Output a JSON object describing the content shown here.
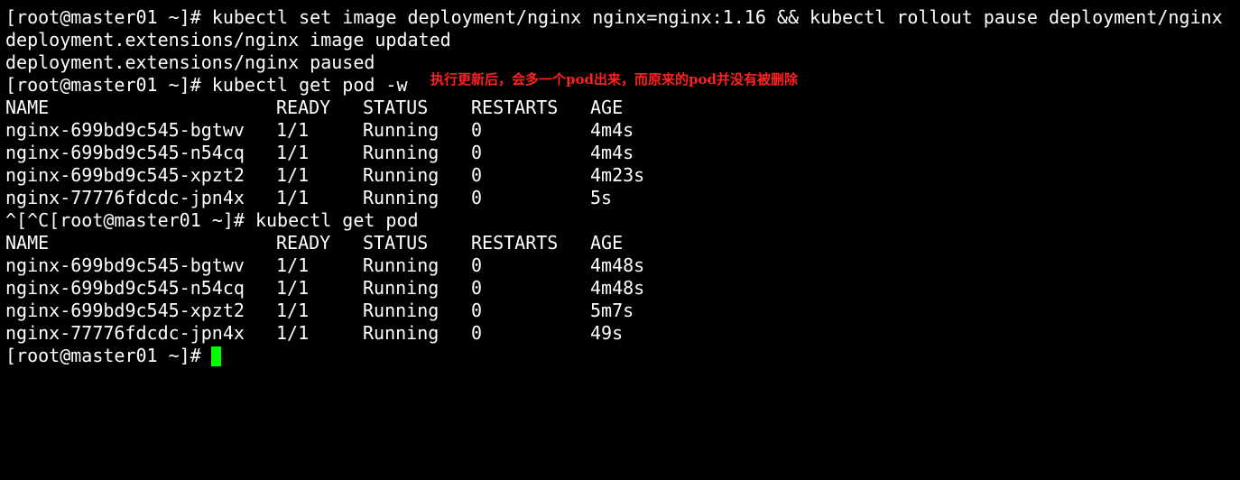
{
  "terminal": {
    "lines": [
      "[root@master01 ~]# kubectl set image deployment/nginx nginx=nginx:1.16 && kubectl rollout pause deployment/nginx",
      "deployment.extensions/nginx image updated",
      "deployment.extensions/nginx paused",
      "[root@master01 ~]# kubectl get pod -w"
    ],
    "annotation": "执行更新后，会多一个pod出来，而原来的pod并没有被删除",
    "table1": {
      "headers": [
        "NAME",
        "READY",
        "STATUS",
        "RESTARTS",
        "AGE"
      ],
      "rows": [
        [
          "nginx-699bd9c545-bgtwv",
          "1/1",
          "Running",
          "0",
          "4m4s"
        ],
        [
          "nginx-699bd9c545-n54cq",
          "1/1",
          "Running",
          "0",
          "4m4s"
        ],
        [
          "nginx-699bd9c545-xpzt2",
          "1/1",
          "Running",
          "0",
          "4m23s"
        ],
        [
          "nginx-77776fdcdc-jpn4x",
          "1/1",
          "Running",
          "0",
          "5s"
        ]
      ]
    },
    "command2": "^[^C[root@master01 ~]# kubectl get pod",
    "table2": {
      "headers": [
        "NAME",
        "READY",
        "STATUS",
        "RESTARTS",
        "AGE"
      ],
      "rows": [
        [
          "nginx-699bd9c545-bgtwv",
          "1/1",
          "Running",
          "0",
          "4m48s"
        ],
        [
          "nginx-699bd9c545-n54cq",
          "1/1",
          "Running",
          "0",
          "4m48s"
        ],
        [
          "nginx-699bd9c545-xpzt2",
          "1/1",
          "Running",
          "0",
          "5m7s"
        ],
        [
          "nginx-77776fdcdc-jpn4x",
          "1/1",
          "Running",
          "0",
          "49s"
        ]
      ]
    },
    "prompt": "[root@master01 ~]# ",
    "colors": {
      "background": "#000000",
      "text": "#ffffff",
      "annotation": "#ff2020",
      "cursor": "#00ff00"
    }
  }
}
